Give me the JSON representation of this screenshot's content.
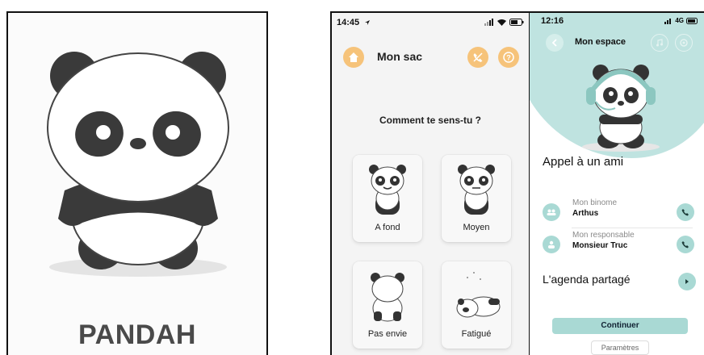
{
  "logo": {
    "brand": "PANDAH"
  },
  "screen_mood": {
    "status": {
      "time": "14:45"
    },
    "title": "Mon sac",
    "question": "Comment te sens-tu ?",
    "moods": [
      {
        "label": "A fond"
      },
      {
        "label": "Moyen"
      },
      {
        "label": "Pas envie"
      },
      {
        "label": "Fatigué"
      }
    ]
  },
  "screen_space": {
    "status": {
      "time": "12:16",
      "network": "4G"
    },
    "title": "Mon espace",
    "call_section": "Appel à un ami",
    "contacts": [
      {
        "role": "Mon binome",
        "name": "Arthus"
      },
      {
        "role": "Mon responsable",
        "name": "Monsieur Truc"
      }
    ],
    "agenda_section": "L'agenda partagé",
    "continue_label": "Continuer",
    "settings_label": "Paramètres"
  },
  "colors": {
    "orange": "#f6c37a",
    "teal": "#a9d9d4",
    "teal_light": "#bfe3e0"
  }
}
